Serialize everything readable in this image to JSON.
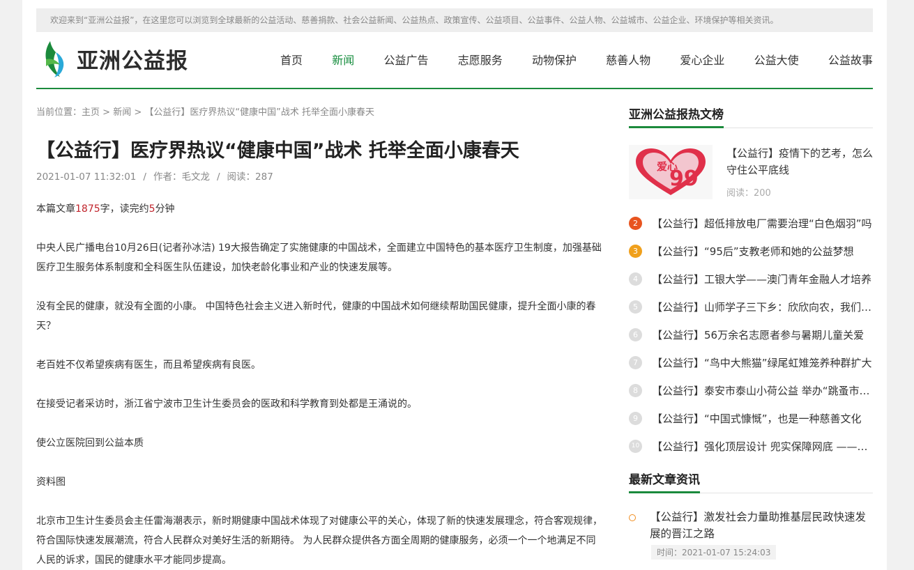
{
  "welcome": "欢迎来到“亚洲公益报”，在这里您可以浏览到全球最新的公益活动、慈善捐款、社会公益新闻、公益热点、政策宣传、公益项目、公益事件、公益人物、公益城市、公益企业、环境保护等相关资讯。",
  "brand": {
    "name": "亚洲公益报",
    "accent": "#1b8a3c"
  },
  "nav": [
    "首页",
    "新闻",
    "公益广告",
    "志愿服务",
    "动物保护",
    "慈善人物",
    "爱心企业",
    "公益大使",
    "公益故事"
  ],
  "breadcrumb": {
    "prefix": "当前位置：",
    "home": "主页",
    "sep": " > ",
    "section": "新闻",
    "current": "【公益行】医疗界热议“健康中国”战术 托举全面小康春天"
  },
  "article": {
    "title": "【公益行】医疗界热议“健康中国”战术 托举全面小康春天",
    "date": "2021-01-07 11:32:01",
    "author": "作者：毛文龙",
    "reads": "阅读：287",
    "stats": {
      "prefix": "本篇文章",
      "chars": "1875",
      "mid": "字，读完约",
      "minutes": "5",
      "suffix": "分钟"
    },
    "paragraphs": [
      "中央人民广播电台10月26日(记者孙冰洁) 19大报告确定了实施健康的中国战术，全面建立中国特色的基本医疗卫生制度，加强基础医疗卫生服务体系制度和全科医生队伍建设，加快老龄化事业和产业的快速发展等。",
      "没有全民的健康，就没有全面的小康。 中国特色社会主义进入新时代，健康的中国战术如何继续帮助国民健康，提升全面小康的春天？",
      "老百姓不仅希望疾病有医生，而且希望疾病有良医。",
      "在接受记者采访时，浙江省宁波市卫生计生委员会的医政和科学教育到处都是王涌说的。",
      "使公立医院回到公益本质",
      "资料图",
      "北京市卫生计生委员会主任雷海潮表示，新时期健康中国战术体现了对健康公平的关心，体现了新的快速发展理念，符合客观规律，符合国际快速发展潮流，符合人民群众对美好生活的新期待。 为人民群众提供各方面全周期的健康服务，必须一个一个地满足不同人民的诉求，国民的健康水平才能同步提高。"
    ]
  },
  "hot": {
    "heading": "亚洲公益报热文榜",
    "top": {
      "thumb_text": "爱心",
      "thumb_num": "99",
      "title": "【公益行】疫情下的艺考，怎么守住公平底线",
      "reads": "阅读：200"
    },
    "items": [
      {
        "num": "2",
        "title": "【公益行】超低排放电厂需要治理“白色烟羽”吗"
      },
      {
        "num": "3",
        "title": "【公益行】“95后”支教老师和她的公益梦想"
      },
      {
        "num": "4",
        "title": "【公益行】工银大学——澳门青年金融人才培养"
      },
      {
        "num": "5",
        "title": "【公益行】山师学子三下乡：欣欣向农，我们同行"
      },
      {
        "num": "6",
        "title": "【公益行】56万余名志愿者参与暑期儿童关爱"
      },
      {
        "num": "7",
        "title": "【公益行】“鸟中大熊猫”绿尾虹雉笼养种群扩大"
      },
      {
        "num": "8",
        "title": "【公益行】泰安市泰山小荷公益 举办“跳蚤市场”"
      },
      {
        "num": "9",
        "title": "【公益行】“中国式慷慨”，也是一种慈善文化"
      },
      {
        "num": "10",
        "title": "【公益行】强化顶层设计 兜实保障网底 ——民政"
      }
    ]
  },
  "latest": {
    "heading": "最新文章资讯",
    "item": {
      "title": "【公益行】激发社会力量助推基层民政快速发展的晋江之路",
      "time": "时间：2021-01-07 15:24:03"
    }
  }
}
